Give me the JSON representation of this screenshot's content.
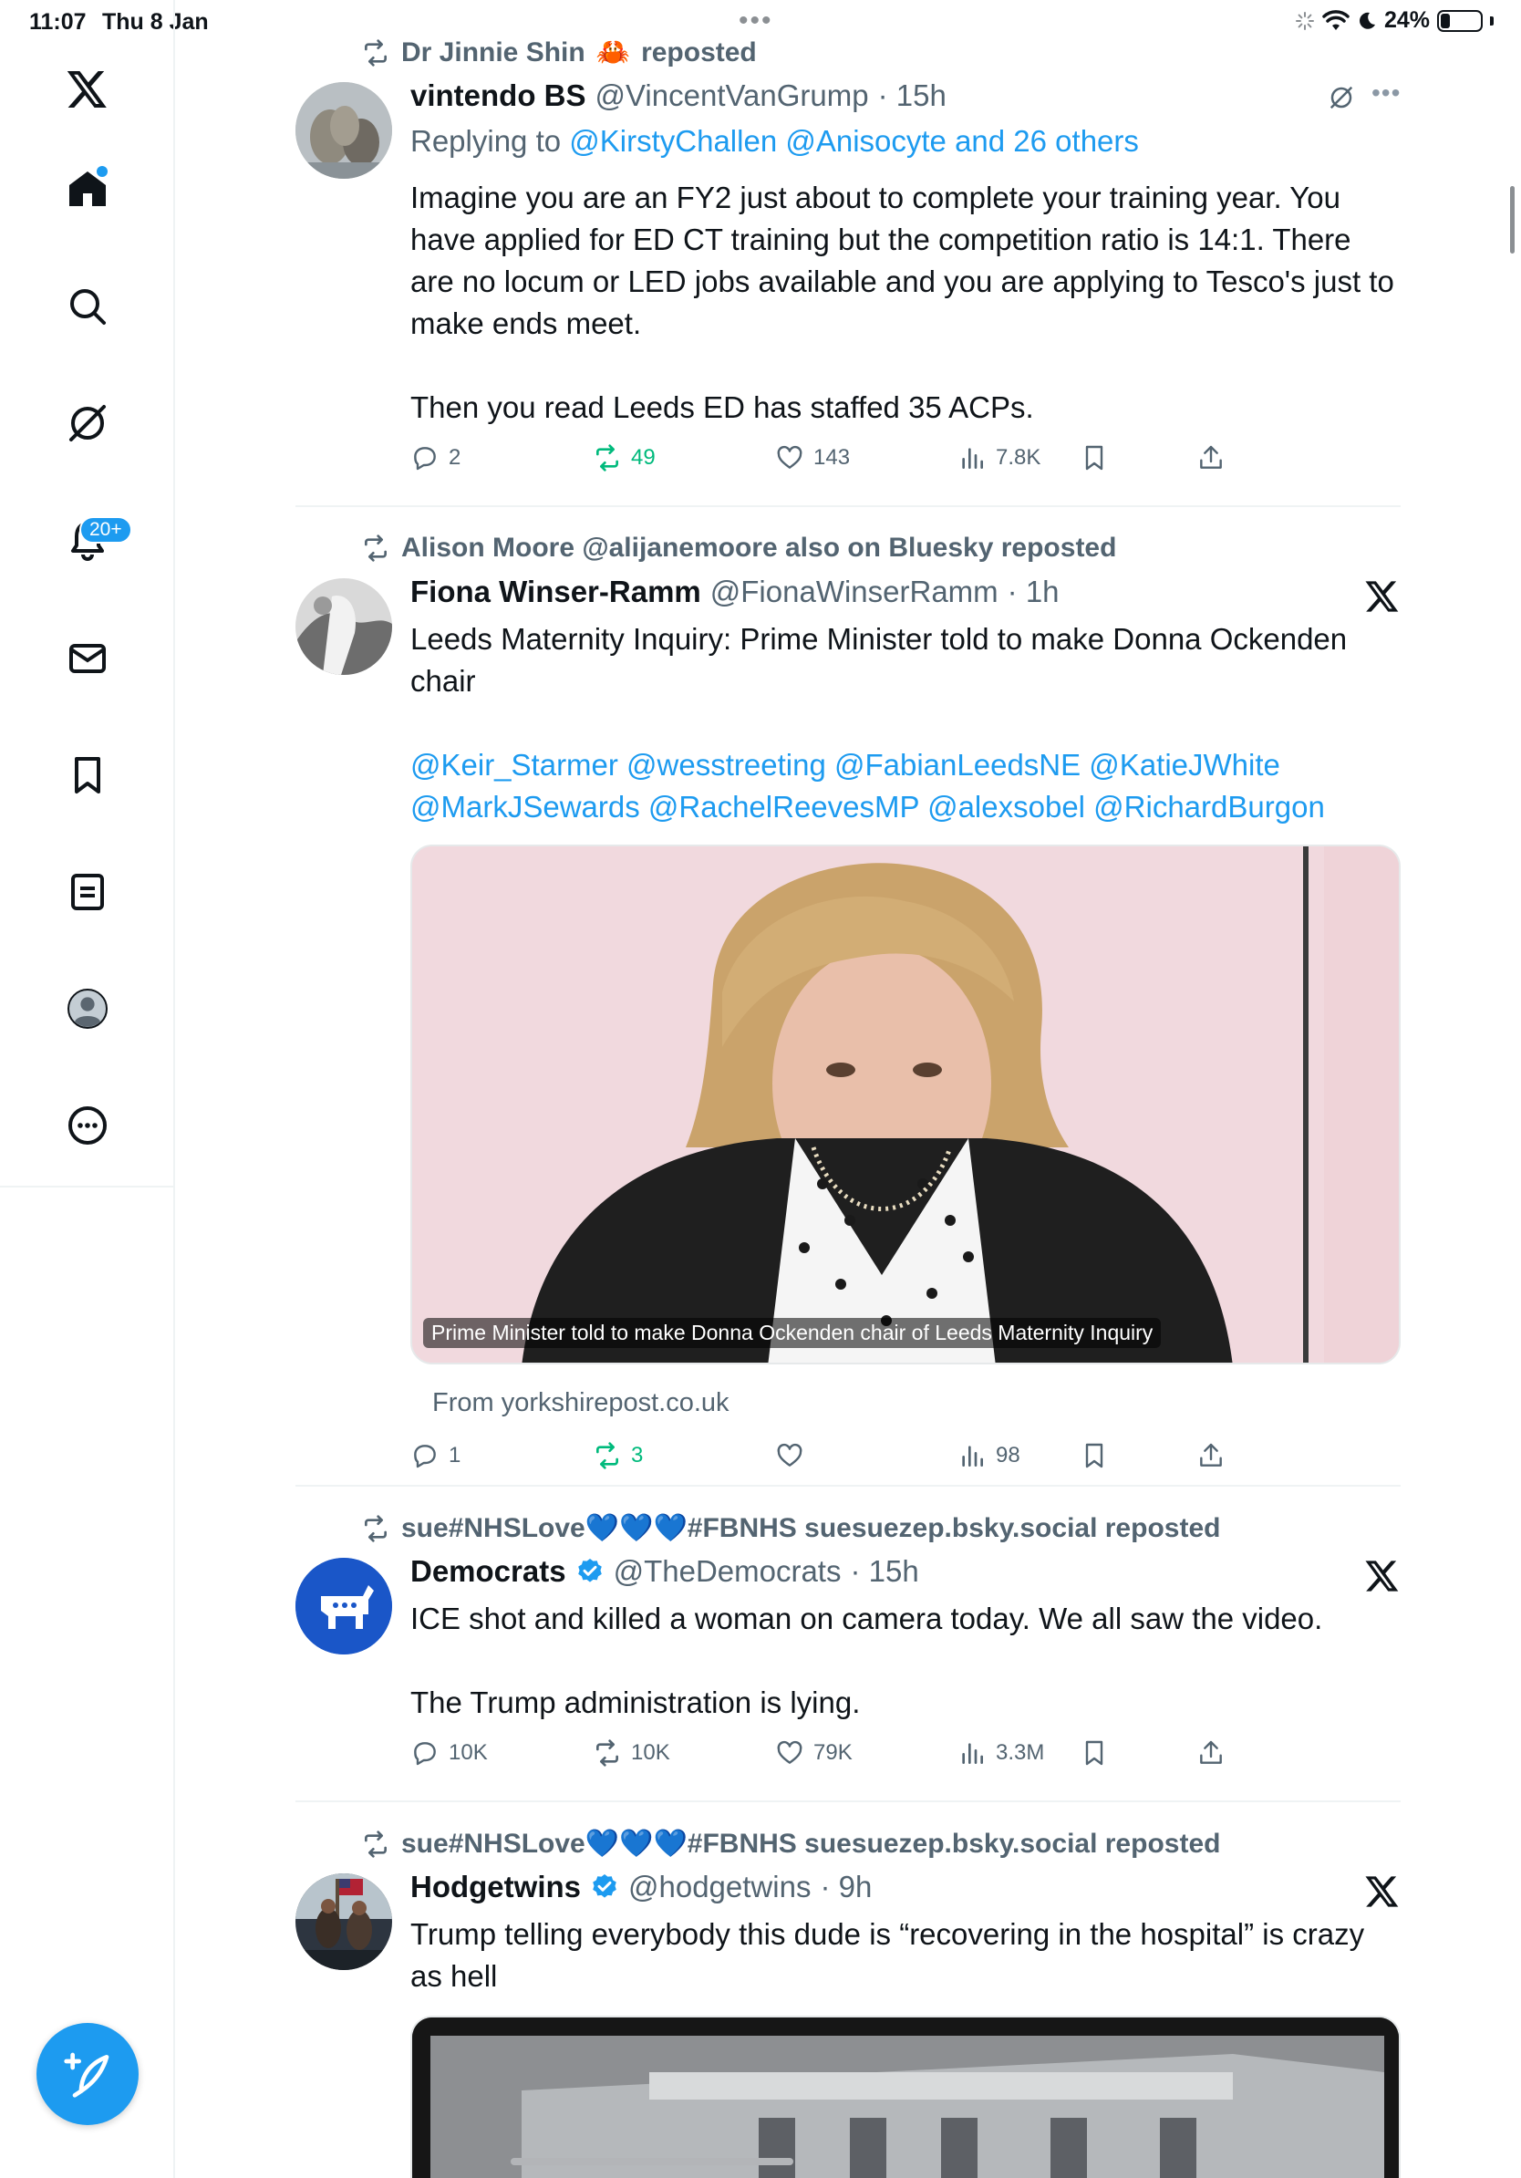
{
  "status_bar": {
    "time": "11:07",
    "date": "Thu 8 Jan",
    "battery_text": "24%",
    "battery_level": 0.24
  },
  "sidebar": {
    "items": [
      {
        "icon": "x-logo-icon"
      },
      {
        "icon": "home-icon"
      },
      {
        "icon": "search-icon"
      },
      {
        "icon": "grok-icon"
      },
      {
        "icon": "notifications-icon",
        "badge": "20+"
      },
      {
        "icon": "messages-icon"
      },
      {
        "icon": "bookmarks-icon"
      },
      {
        "icon": "lists-icon"
      },
      {
        "icon": "profile-icon"
      },
      {
        "icon": "more-icon"
      }
    ],
    "compose_icon": "compose-post-icon"
  },
  "posts": [
    {
      "repost_by": "Dr Jinnie Shin",
      "repost_emoji": "🦀",
      "repost_suffix": "reposted",
      "name": "vintendo BS",
      "handle": "@VincentVanGrump",
      "time": "· 15h",
      "replying_prefix": "Replying to ",
      "replying_to": "@KirstyChallen @Anisocyte and 26 others",
      "text": "Imagine you are an FY2 just about to complete your training year. You have applied for ED CT training but the competition ratio is 14:1. There are no locum or LED jobs available and you are applying to Tesco's just to make ends meet.",
      "text2": "Then you read Leeds ED has staffed 35 ACPs.",
      "replies": "2",
      "reposts": "49",
      "likes": "143",
      "views": "7.8K"
    },
    {
      "repost_line": "Alison Moore @alijanemoore also on Bluesky reposted",
      "name": "Fiona Winser-Ramm",
      "handle": "@FionaWinserRamm",
      "time": "· 1h",
      "text": "Leeds Maternity Inquiry: Prime Minister told to make Donna Ockenden chair",
      "mentions_line1": "@Keir_Starmer @wesstreeting @FabianLeedsNE @KatieJWhite",
      "mentions_line2": "@MarkJSewards @RachelReevesMP  @alexsobel @RichardBurgon",
      "media_caption": "Prime Minister told to make Donna Ockenden chair of Leeds Maternity Inquiry",
      "source": "From yorkshirepost.co.uk",
      "replies": "1",
      "reposts": "3",
      "likes": "",
      "views": "98"
    },
    {
      "repost_line": "sue#NHSLove💙💙💙#FBNHS suesuezep.bsky.social reposted",
      "name": "Democrats",
      "handle": "@TheDemocrats",
      "time": "· 15h",
      "text": "ICE shot and killed a woman on camera today. We all saw the video.",
      "text2": "The Trump administration is lying.",
      "replies": "10K",
      "reposts": "10K",
      "likes": "79K",
      "views": "3.3M"
    },
    {
      "repost_line": "sue#NHSLove💙💙💙#FBNHS suesuezep.bsky.social reposted",
      "name": "Hodgetwins",
      "handle": "@hodgetwins",
      "time": "· 9h",
      "text": "Trump telling everybody this dude is “recovering in the hospital” is crazy as hell"
    }
  ]
}
